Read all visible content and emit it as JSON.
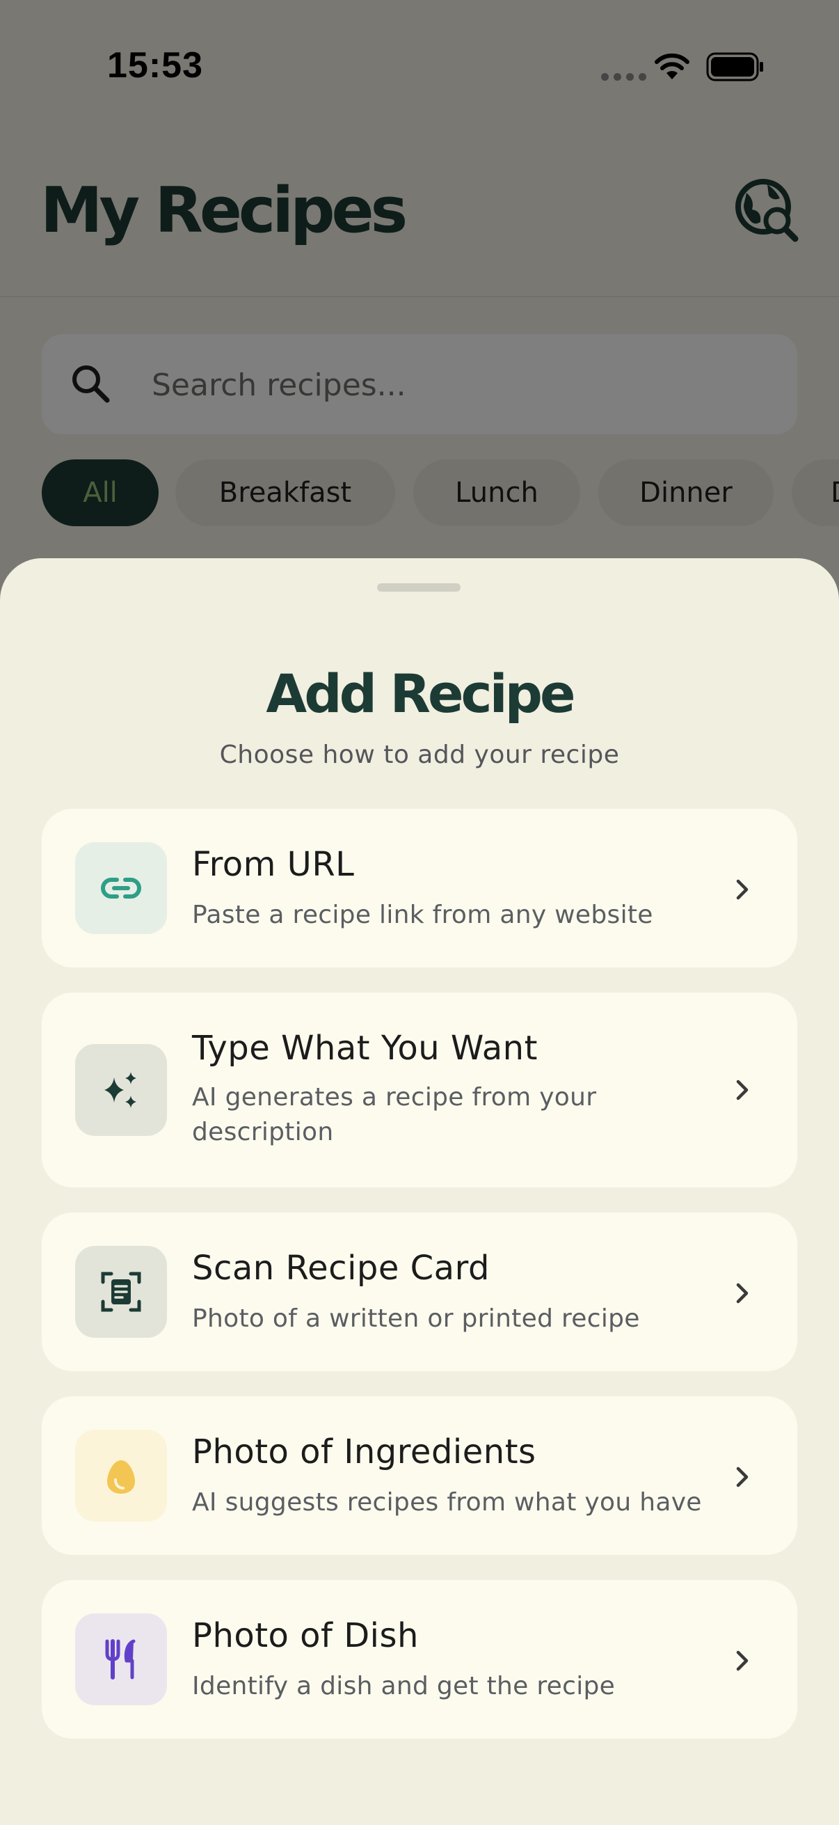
{
  "status_bar": {
    "time": "15:53"
  },
  "header": {
    "title": "My Recipes",
    "action_icon": "globe-search-icon"
  },
  "search": {
    "placeholder": "Search recipes..."
  },
  "filters": {
    "selected": "All",
    "chips": [
      "All",
      "Breakfast",
      "Lunch",
      "Dinner",
      "D"
    ]
  },
  "sheet": {
    "title": "Add Recipe",
    "subtitle": "Choose how to add your recipe",
    "options": [
      {
        "title": "From URL",
        "description": "Paste a recipe link from any website",
        "icon": "link-icon",
        "icon_color": "#2f9e86",
        "icon_bg": "#e5efe6"
      },
      {
        "title": "Type What You Want",
        "description": "AI generates a recipe from your description",
        "icon": "sparkles-icon",
        "icon_color": "#1d3b35",
        "icon_bg": "#e3e4d9"
      },
      {
        "title": "Scan Recipe Card",
        "description": "Photo of a written or printed recipe",
        "icon": "scan-document-icon",
        "icon_color": "#1d3b35",
        "icon_bg": "#e3e4d9"
      },
      {
        "title": "Photo of Ingredients",
        "description": "AI suggests recipes from what you have",
        "icon": "egg-icon",
        "icon_color": "#f3c552",
        "icon_bg": "#fcf4d8"
      },
      {
        "title": "Photo of Dish",
        "description": "Identify a dish and get the recipe",
        "icon": "utensils-icon",
        "icon_color": "#6140c9",
        "icon_bg": "#ebe6ee"
      }
    ]
  },
  "colors": {
    "brand_dark": "#1d3b35",
    "sheet_bg": "#f0efe0",
    "card_bg": "#fdfbee",
    "accent_green": "#9bbf76"
  }
}
